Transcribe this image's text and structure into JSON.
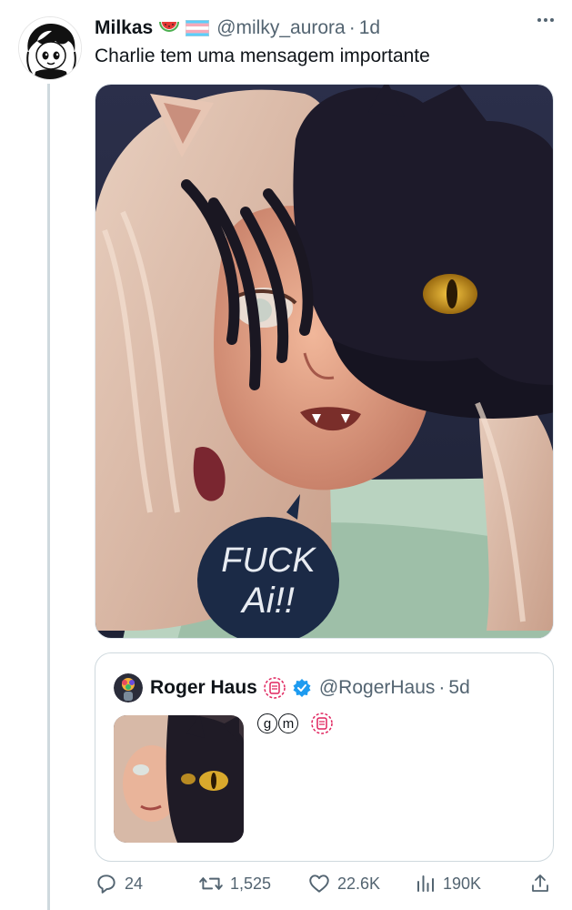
{
  "tweet": {
    "author_name": "Milkas",
    "name_emojis": [
      "watermelon-icon",
      "trans-flag-icon"
    ],
    "handle": "@milky_aurora",
    "separator": "·",
    "time": "1d",
    "text": "Charlie tem uma mensagem importante",
    "image_sign_text": "FUCK Ai!!"
  },
  "quote": {
    "author_name": "Roger Haus",
    "handle": "@RogerHaus",
    "separator": "·",
    "time": "5d",
    "verified": true,
    "text_g": "g",
    "text_m": "m"
  },
  "actions": {
    "replies": "24",
    "reposts": "1,525",
    "likes": "22.6K",
    "views": "190K"
  },
  "colors": {
    "muted": "#536471",
    "verified": "#1d9bf0",
    "border": "#cfd9de",
    "brand_red": "#e0245e"
  }
}
